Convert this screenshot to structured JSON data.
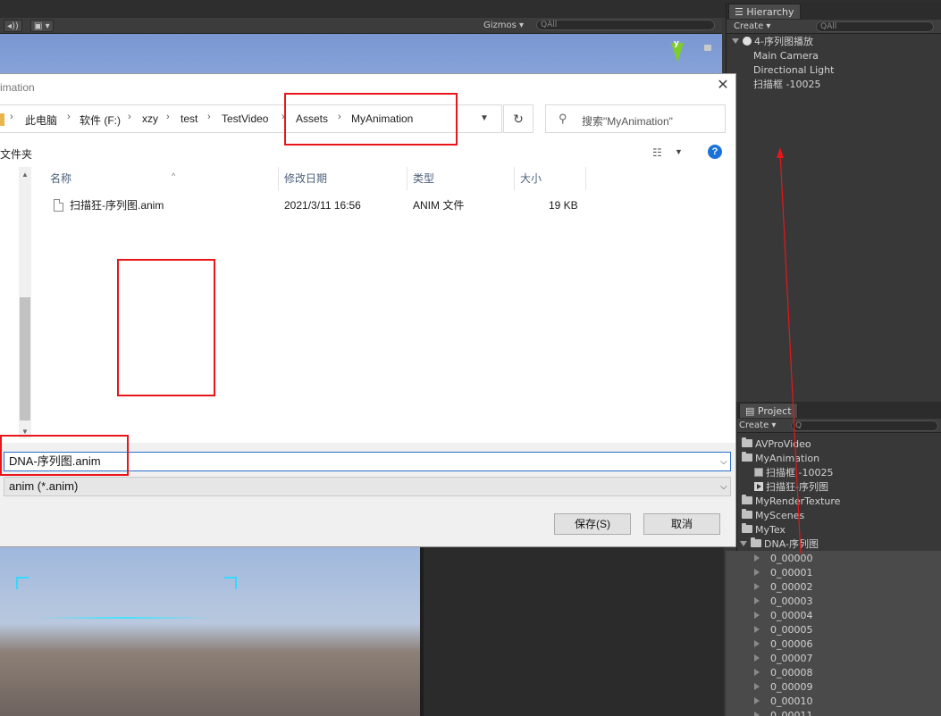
{
  "unity": {
    "toolbar": {
      "gizmos_label": "Gizmos",
      "search_placeholder": "All"
    },
    "gizmo_axis": "y",
    "hierarchy": {
      "tab_label": "Hierarchy",
      "create_label": "Create",
      "search_placeholder": "All",
      "scene_name": "4-序列图播放",
      "items": [
        "Main Camera",
        "Directional Light",
        "扫描框 -10025"
      ]
    },
    "project": {
      "tab_label": "Project",
      "create_label": "Create",
      "items": [
        {
          "label": "AVProVideo",
          "kind": "folder"
        },
        {
          "label": "MyAnimation",
          "kind": "folder"
        },
        {
          "label": "扫描框 -10025",
          "kind": "asset"
        },
        {
          "label": "扫描狂-序列图",
          "kind": "anim"
        },
        {
          "label": "MyRenderTexture",
          "kind": "folder"
        },
        {
          "label": "MyScenes",
          "kind": "folder"
        },
        {
          "label": "MyTex",
          "kind": "folder"
        },
        {
          "label": "DNA-序列图",
          "kind": "folder-open"
        }
      ],
      "frames": [
        "0_00000",
        "0_00001",
        "0_00002",
        "0_00003",
        "0_00004",
        "0_00005",
        "0_00006",
        "0_00007",
        "0_00008",
        "0_00009",
        "0_00010",
        "0_00011"
      ]
    }
  },
  "dialog": {
    "title_fragment": "imation",
    "close_glyph": "✕",
    "breadcrumbs": [
      "此电脑",
      "软件 (F:)",
      "xzy",
      "test",
      "TestVideo",
      "Assets",
      "MyAnimation"
    ],
    "search_placeholder": "搜索\"MyAnimation\"",
    "new_folder_fragment": "文件夹",
    "nav_fragment": ")",
    "columns": [
      "名称",
      "修改日期",
      "类型",
      "大小"
    ],
    "files": [
      {
        "name": "扫描狂-序列图.anim",
        "modified": "2021/3/11 16:56",
        "type": "ANIM 文件",
        "size": "19 KB"
      }
    ],
    "filename_value": "DNA-序列图.anim",
    "filetype_value": "anim (*.anim)",
    "save_label": "保存(S)",
    "cancel_label": "取消"
  },
  "colors": {
    "annotation_red": "#e8161b",
    "accent_blue": "#1a73d6",
    "unity_panel": "#383838"
  }
}
